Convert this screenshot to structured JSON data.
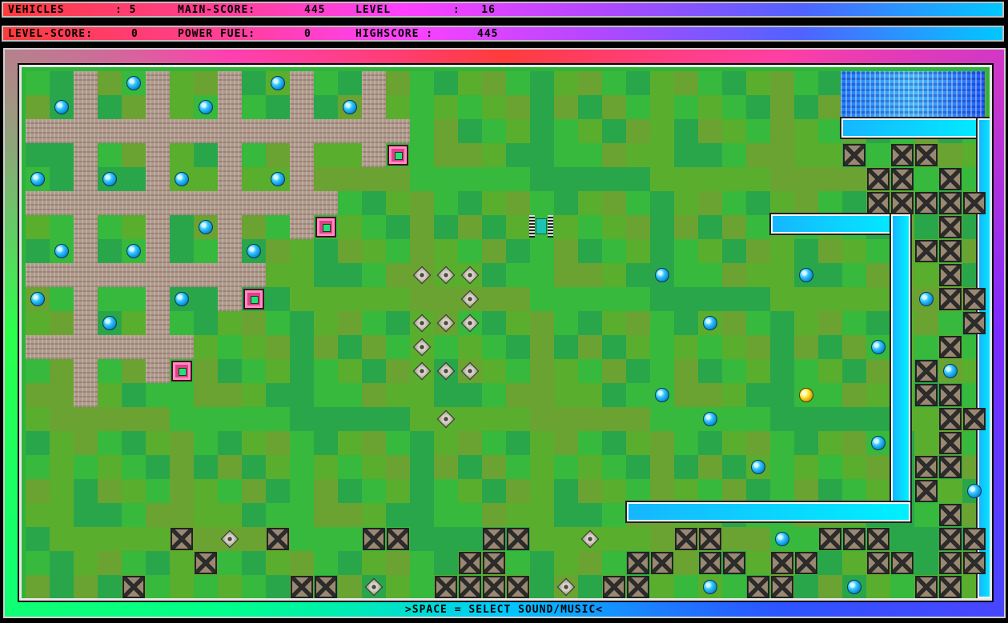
{
  "hud": {
    "vehicles_label": "VEHICLES",
    "vehicles_value": ": 5",
    "main_score_label": "MAIN-SCORE:",
    "main_score_value": "445",
    "level_label": "LEVEL",
    "level_value": ":   16",
    "level_score_label": "LEVEL-SCORE:",
    "level_score_value": "0",
    "power_fuel_label": "POWER FUEL:",
    "power_fuel_value": "0",
    "highscore_label": "HIGHSCORE :",
    "highscore_value": "445"
  },
  "footer": {
    "hint": ">SPACE = SELECT SOUND/MUSIC<"
  },
  "icons": {
    "player": "tank-icon",
    "pickup": "blue-orb-icon",
    "bonus": "gold-orb-icon",
    "hazard": "mine-icon",
    "obstacle": "crate-icon",
    "base": "depot-icon"
  },
  "colors": {
    "hud_gradient_start": "#ff3b3b",
    "hud_gradient_end": "#00c8ff",
    "pipe": "#16b6ff",
    "grass": "#36b93c",
    "road": "#b09a8c"
  }
}
